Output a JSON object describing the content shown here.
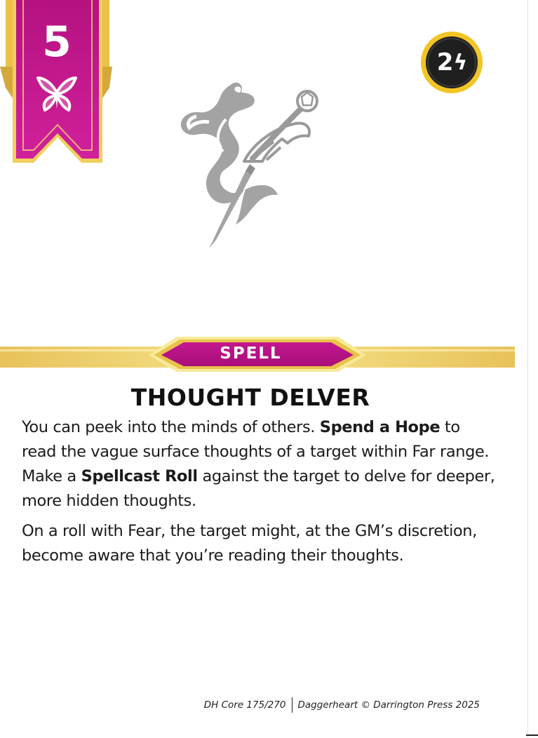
{
  "card": {
    "level": "5",
    "recall_cost": "2",
    "type": "SPELL",
    "title": "THOUGHT DELVER",
    "body": {
      "p1": {
        "t1": "You can peek into the minds of others. ",
        "b1": "Spend a Hope",
        "t2": " to read the vague surface thoughts of a target within Far range. Make a ",
        "b2": "Spellcast Roll",
        "t3": " against the target to delve for deeper, more hidden thoughts."
      },
      "p2": "On a roll with Fear, the target might, at the GM’s discretion, become aware that you’re reading their thoughts."
    },
    "footer": {
      "left": "DH Core 175/270",
      "right": "Daggerheart © Darrington Press 2025"
    }
  },
  "icons": {
    "banner": "butterfly-icon",
    "cost": "bolt-icon",
    "art": "serpent-dagger-art"
  },
  "colors": {
    "domain": "#c3168f",
    "domain_dark": "#8c0c66",
    "gold": "#f2d45a",
    "cost_ring": "#f2c425",
    "cost_fill": "#1f1f1f"
  }
}
